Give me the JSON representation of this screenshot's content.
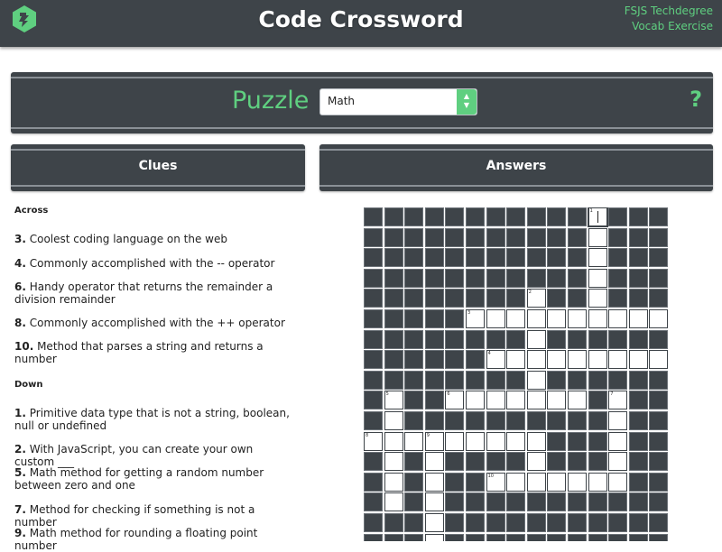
{
  "header": {
    "title": "Code Crossword",
    "top_right_line1": "FSJS Techdegree",
    "top_right_line2": "Vocab Exercise",
    "logo_icon": "treehouse-logo-icon"
  },
  "puzzle_bar": {
    "label": "Puzzle",
    "select_value": "Math",
    "help_label": "?"
  },
  "tabs": {
    "clues": "Clues",
    "answers": "Answers"
  },
  "clues": {
    "across_heading": "Across",
    "across": [
      {
        "num": "3.",
        "text": " Coolest coding language on the web"
      },
      {
        "num": "4.",
        "text": " Commonly accomplished with the -- operator"
      },
      {
        "num": "6.",
        "text": " Handy operator that returns the remainder a division remainder"
      },
      {
        "num": "8.",
        "text": " Commonly accomplished with the ++ operator"
      },
      {
        "num": "10.",
        "text": " Method that parses a string and returns a number"
      }
    ],
    "down_heading": "Down",
    "down": [
      {
        "num": "1.",
        "text": " Primitive data type that is not a string, boolean, null or undefined"
      },
      {
        "num": "2.",
        "text": " With JavaScript, you can create your own custom ___"
      },
      {
        "num": "5.",
        "text": " Math method for getting a random number between zero and one"
      },
      {
        "num": "7.",
        "text": " Method for checking if something is not a number"
      },
      {
        "num": "9.",
        "text": " Math method for rounding a floating point number"
      }
    ]
  },
  "grid": {
    "cols": 15,
    "rows": 17,
    "white_cells": [
      [
        0,
        11
      ],
      [
        1,
        11
      ],
      [
        2,
        11
      ],
      [
        3,
        11
      ],
      [
        4,
        8
      ],
      [
        4,
        11
      ],
      [
        5,
        5
      ],
      [
        5,
        6
      ],
      [
        5,
        7
      ],
      [
        5,
        8
      ],
      [
        5,
        9
      ],
      [
        5,
        10
      ],
      [
        5,
        11
      ],
      [
        5,
        12
      ],
      [
        5,
        13
      ],
      [
        5,
        14
      ],
      [
        6,
        8
      ],
      [
        7,
        6
      ],
      [
        7,
        7
      ],
      [
        7,
        8
      ],
      [
        7,
        9
      ],
      [
        7,
        10
      ],
      [
        7,
        11
      ],
      [
        7,
        12
      ],
      [
        7,
        13
      ],
      [
        7,
        14
      ],
      [
        8,
        8
      ],
      [
        9,
        1
      ],
      [
        9,
        4
      ],
      [
        9,
        5
      ],
      [
        9,
        6
      ],
      [
        9,
        7
      ],
      [
        9,
        8
      ],
      [
        9,
        9
      ],
      [
        9,
        10
      ],
      [
        9,
        12
      ],
      [
        10,
        1
      ],
      [
        10,
        12
      ],
      [
        11,
        0
      ],
      [
        11,
        1
      ],
      [
        11,
        2
      ],
      [
        11,
        3
      ],
      [
        11,
        4
      ],
      [
        11,
        5
      ],
      [
        11,
        6
      ],
      [
        11,
        7
      ],
      [
        11,
        8
      ],
      [
        11,
        12
      ],
      [
        12,
        1
      ],
      [
        12,
        3
      ],
      [
        12,
        8
      ],
      [
        12,
        12
      ],
      [
        13,
        1
      ],
      [
        13,
        3
      ],
      [
        13,
        6
      ],
      [
        13,
        7
      ],
      [
        13,
        8
      ],
      [
        13,
        9
      ],
      [
        13,
        10
      ],
      [
        13,
        11
      ],
      [
        13,
        12
      ],
      [
        14,
        1
      ],
      [
        14,
        3
      ],
      [
        15,
        3
      ],
      [
        16,
        3
      ]
    ],
    "numbers": [
      {
        "r": 0,
        "c": 11,
        "n": "1"
      },
      {
        "r": 4,
        "c": 8,
        "n": "2"
      },
      {
        "r": 5,
        "c": 5,
        "n": "3"
      },
      {
        "r": 7,
        "c": 6,
        "n": "4"
      },
      {
        "r": 9,
        "c": 1,
        "n": "5"
      },
      {
        "r": 9,
        "c": 4,
        "n": "6"
      },
      {
        "r": 9,
        "c": 12,
        "n": "7"
      },
      {
        "r": 11,
        "c": 0,
        "n": "8"
      },
      {
        "r": 11,
        "c": 3,
        "n": "9"
      },
      {
        "r": 13,
        "c": 6,
        "n": "10"
      }
    ],
    "active": [
      0,
      11
    ]
  }
}
